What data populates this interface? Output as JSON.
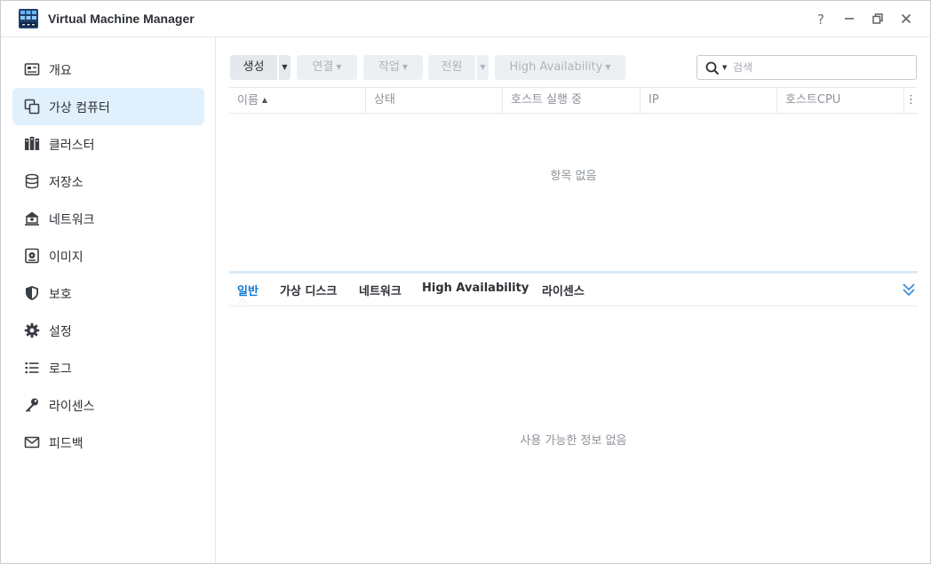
{
  "app": {
    "title": "Virtual Machine Manager",
    "icon": "vmm-app-icon",
    "window_controls": {
      "help": "?",
      "minimize": "−",
      "restore": "❐",
      "close": "✕"
    }
  },
  "sidebar": {
    "items": [
      {
        "label": "개요",
        "icon": "overview-icon"
      },
      {
        "label": "가상 컴퓨터",
        "icon": "virtual-machine-icon",
        "active": true
      },
      {
        "label": "클러스터",
        "icon": "cluster-icon"
      },
      {
        "label": "저장소",
        "icon": "storage-icon"
      },
      {
        "label": "네트워크",
        "icon": "network-icon"
      },
      {
        "label": "이미지",
        "icon": "image-icon"
      },
      {
        "label": "보호",
        "icon": "shield-icon"
      },
      {
        "label": "설정",
        "icon": "gear-icon"
      },
      {
        "label": "로그",
        "icon": "log-list-icon"
      },
      {
        "label": "라이센스",
        "icon": "key-icon"
      },
      {
        "label": "피드백",
        "icon": "mail-icon"
      }
    ]
  },
  "toolbar": {
    "create": "생성",
    "connect": "연결",
    "action": "작업",
    "power": "전원",
    "high_availability": "High Availability"
  },
  "search": {
    "placeholder": "검색",
    "value": ""
  },
  "grid": {
    "columns": [
      "이름",
      "상태",
      "호스트 실행 중",
      "IP",
      "호스트CPU"
    ],
    "sort_column": "이름",
    "sort_direction": "ascending",
    "rows": [],
    "empty_message": "항목 없음"
  },
  "details": {
    "tabs": [
      "일반",
      "가상 디스크",
      "네트워크",
      "High Availability",
      "라이센스"
    ],
    "active_tab": "일반",
    "empty_message": "사용 가능한 정보 없음"
  },
  "colors": {
    "accent": "#0b77d8",
    "active_nav_bg": "#e1f0fd",
    "muted_text": "#8c9299"
  }
}
